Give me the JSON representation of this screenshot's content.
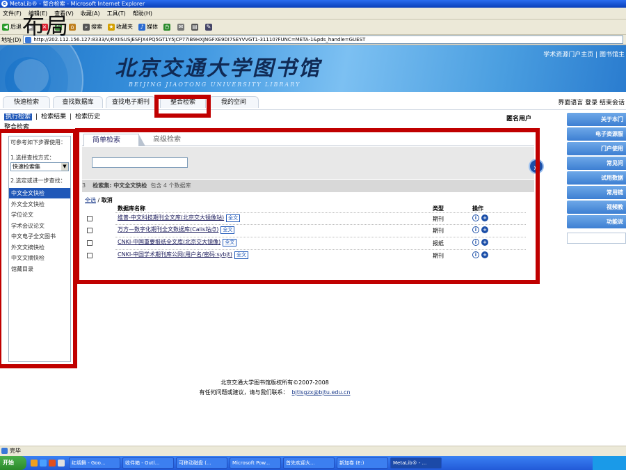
{
  "window": {
    "title": "MetaLib® - 整合检索 - Microsoft Internet Explorer",
    "menu": [
      "文件(F)",
      "编辑(E)",
      "查看(V)",
      "收藏(A)",
      "工具(T)",
      "帮助(H)"
    ],
    "toolbar": [
      "后退",
      "搜索",
      "收藏夹",
      "媒体"
    ],
    "address_label": "地址(D)",
    "address": "http://202.112.156.127:8333/V/RXIISUSJESFJX4PQ5GT1Y5JCP77IB9HXJNGFXE9DI7SEYVVGT1-31110?FUNC=META-1&pds_handle=GUEST"
  },
  "overlay_title": "布局",
  "banner": {
    "logo_cn": "北京交通大学图书馆",
    "logo_en": "BEIJING JIAOTONG UNIVERSITY LIBRARY",
    "top_links": "学术资源门户主页 | 图书馆主"
  },
  "nav": {
    "tabs": [
      "快速检索",
      "查找数据库",
      "查找电子期刊",
      "整合检索",
      "我的空间"
    ],
    "right": "界面语言  登录  结束会话"
  },
  "subnav": {
    "items": [
      "执行检索",
      "检索结果",
      "检索历史"
    ]
  },
  "crumb": "整合检索",
  "anon_user": "匿名用户",
  "right_menu": [
    "关于本门",
    "电子资源服",
    "门户使用",
    "常见问",
    "试用数据",
    "常用链",
    "视频教",
    "功能说"
  ],
  "left": {
    "hint": "可参考如下步骤使用：",
    "step1": "1.选择查找方式：",
    "select_value": "快速检索集",
    "step2": "2.选定或进一步查找：",
    "sets": [
      "中文全文快检",
      "外文全文快检",
      "学位论文",
      "学术会议论文",
      "中文电子全文图书",
      "外文文摘快检",
      "中文文摘快检",
      "馆藏目录"
    ]
  },
  "search": {
    "tab_simple": "简单检索",
    "tab_advanced": "高级检索",
    "set_line_num": "3",
    "set_line_label": "检索集: 中文全文快检",
    "set_line_rest": "包含  4 个数据库",
    "select_all": "全选",
    "deselect": "取消",
    "col_name": "数据库名称",
    "col_type": "类型",
    "col_ops": "操作",
    "fulltext_badge": "全文",
    "rows": [
      {
        "name": "维普-中文科技期刊全文库(北京交大镜像站)",
        "type": "期刊"
      },
      {
        "name": "万方—数字化期刊全文数据库(Calis站点)",
        "type": "期刊"
      },
      {
        "name": "CNKI-中国重要报纸全文库(北京交大镜像)",
        "type": "报纸"
      },
      {
        "name": "CNKI-中国学术期刊库公网(用户名/密码:sybjt)",
        "type": "期刊"
      }
    ]
  },
  "footer": {
    "line1": "北京交通大学图书馆版权所有©2007-2008",
    "line2": "有任何问题或建议，请与我们联系：",
    "email": "bjtlsgzx@bjtu.edu.cn"
  },
  "status": "完毕",
  "taskbar": {
    "start": "开始",
    "items": [
      "红绸舞 - Goo...",
      "收件箱 - Outl...",
      "可移动磁盘 (...",
      "Microsoft Pow...",
      "首先欢迎大...",
      "新加卷 (E:)",
      "MetaLib® - ..."
    ]
  },
  "colors": {
    "highlight": "#c00000",
    "accent": "#2058b8"
  }
}
